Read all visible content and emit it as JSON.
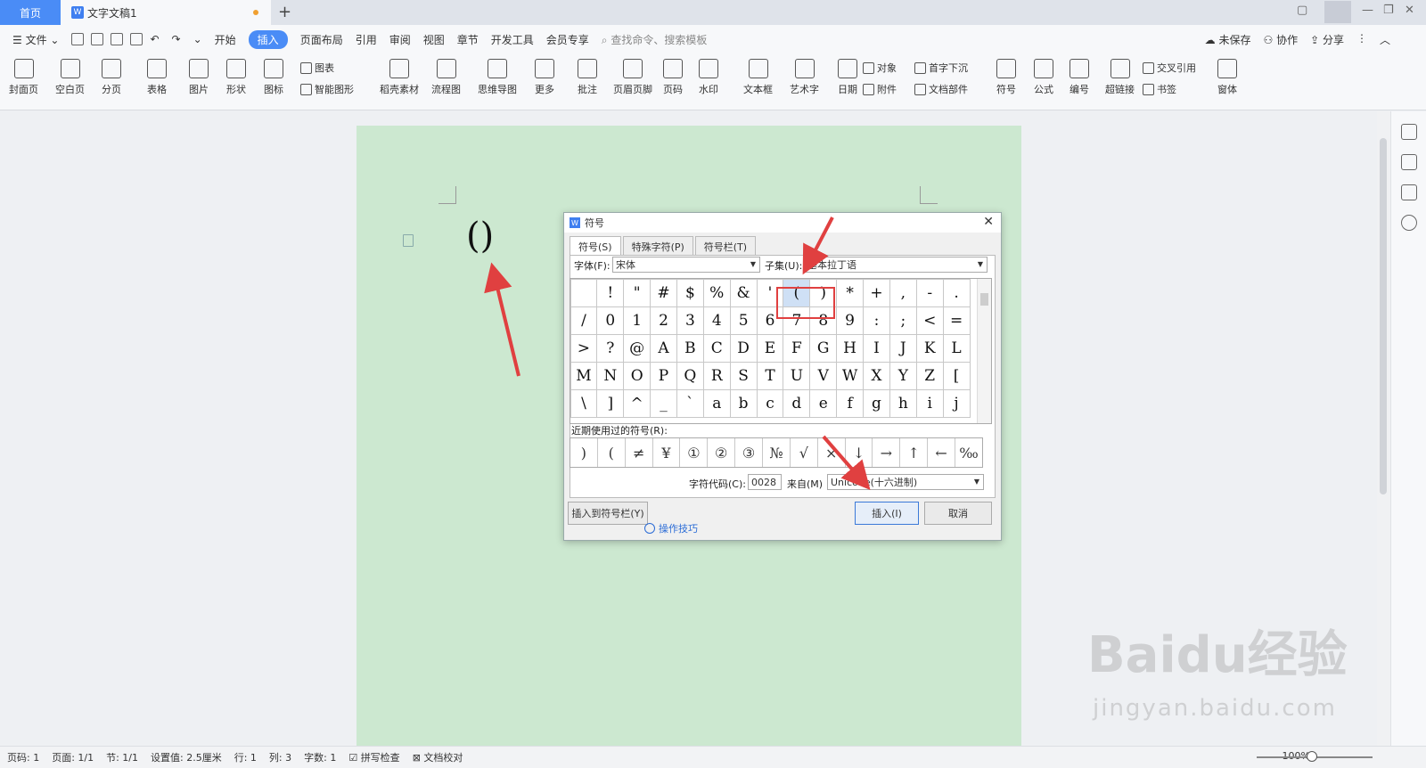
{
  "tabs": {
    "home": "首页",
    "doc": "文字文稿1"
  },
  "menubar": {
    "file": "文件",
    "items": [
      "开始",
      "插入",
      "页面布局",
      "引用",
      "审阅",
      "视图",
      "章节",
      "开发工具",
      "会员专享"
    ],
    "active": "插入",
    "search": "查找命令、搜索模板",
    "right": [
      "未保存",
      "协作",
      "分享"
    ]
  },
  "ribbon": {
    "big": [
      "封面页",
      "空白页",
      "分页",
      "表格",
      "图片",
      "形状",
      "图标",
      "稻壳素材",
      "流程图",
      "思维导图",
      "更多",
      "批注",
      "页眉页脚",
      "页码",
      "水印",
      "文本框",
      "艺术字",
      "日期",
      "符号",
      "公式",
      "编号",
      "超链接",
      "窗体"
    ],
    "small": [
      "图表",
      "智能图形",
      "对象",
      "附件",
      "首字下沉",
      "文档部件",
      "交叉引用",
      "书签"
    ]
  },
  "document": {
    "content": "()"
  },
  "dialog": {
    "title": "符号",
    "tabs": [
      "符号(S)",
      "特殊字符(P)",
      "符号栏(T)"
    ],
    "font_label": "字体(F):",
    "font_value": "宋体",
    "subset_label": "子集(U):",
    "subset_value": "基本拉丁语",
    "symbols": [
      " ",
      "!",
      "\"",
      "#",
      "$",
      "%",
      "&",
      "'",
      "(",
      ")",
      "*",
      "+",
      ",",
      "-",
      ".",
      "/",
      "0",
      "1",
      "2",
      "3",
      "4",
      "5",
      "6",
      "7",
      "8",
      "9",
      ":",
      ";",
      "<",
      "=",
      ">",
      "?",
      "@",
      "A",
      "B",
      "C",
      "D",
      "E",
      "F",
      "G",
      "H",
      "I",
      "J",
      "K",
      "L",
      "M",
      "N",
      "O",
      "P",
      "Q",
      "R",
      "S",
      "T",
      "U",
      "V",
      "W",
      "X",
      "Y",
      "Z",
      "[",
      "\\",
      "]",
      "^",
      "_",
      "`",
      "a",
      "b",
      "c",
      "d",
      "e",
      "f",
      "g",
      "h",
      "i",
      "j"
    ],
    "selected_index": 8,
    "recent_label": "近期使用过的符号(R):",
    "recent": [
      ")",
      "(",
      "≠",
      "¥",
      "①",
      "②",
      "③",
      "№",
      "√",
      "×",
      "↓",
      "→",
      "↑",
      "←",
      "‰"
    ],
    "code_label": "字符代码(C):",
    "code_value": "0028",
    "from_label": "来自(M)",
    "from_value": "Unicode(十六进制)",
    "insert_to_bar": "插入到符号栏(Y)",
    "tips": "操作技巧",
    "insert": "插入(I)",
    "cancel": "取消"
  },
  "statusbar": {
    "items": [
      "页码: 1",
      "页面: 1/1",
      "节: 1/1",
      "设置值: 2.5厘米",
      "行: 1",
      "列: 3",
      "字数: 1",
      "拼写检查",
      "文档校对"
    ],
    "zoom": "100%"
  },
  "watermark": {
    "brand": "Baidu经验",
    "url": "jingyan.baidu.com"
  },
  "colors": {
    "accent": "#4a8cf6",
    "page": "#cce8d0",
    "arrow": "#e04040"
  }
}
